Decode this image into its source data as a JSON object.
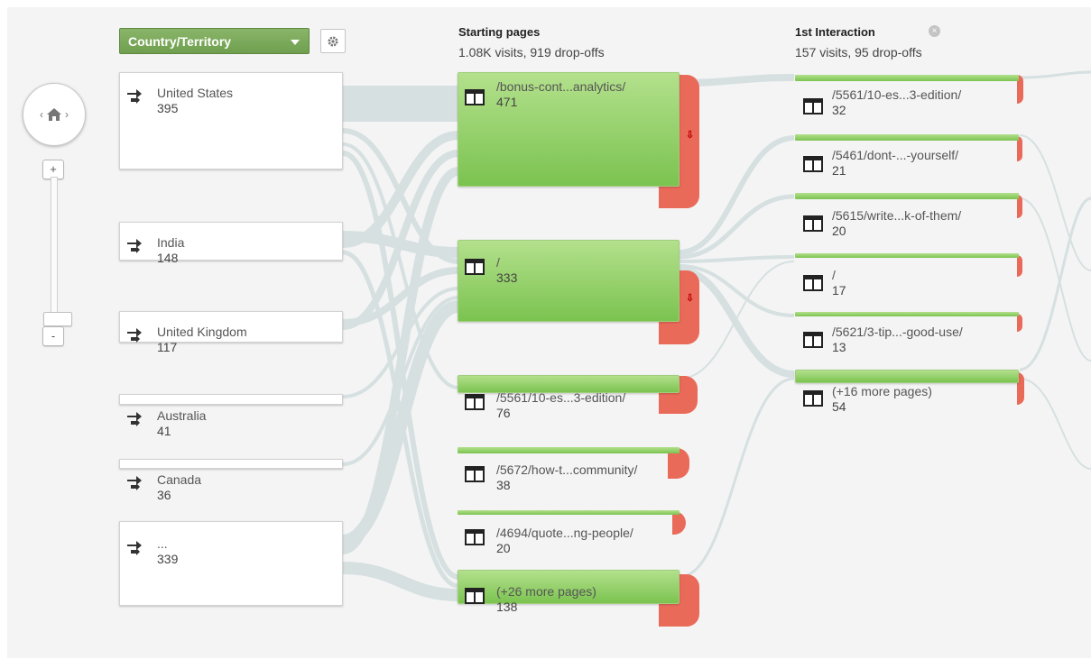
{
  "controls": {
    "home_icon": "home-icon",
    "zoom_in_label": "+",
    "zoom_out_label": "-",
    "dimension_select_value": "Country/Territory",
    "settings_icon": "gear-icon"
  },
  "columns": [
    {
      "title": "Starting pages",
      "summary": "1.08K visits, 919 drop-offs"
    },
    {
      "title": "1st Interaction",
      "summary": "157 visits, 95 drop-offs"
    }
  ],
  "countries": [
    {
      "name": "United States",
      "count": "395"
    },
    {
      "name": "India",
      "count": "148"
    },
    {
      "name": "United Kingdom",
      "count": "117"
    },
    {
      "name": "Australia",
      "count": "41"
    },
    {
      "name": "Canada",
      "count": "36"
    },
    {
      "name": "...",
      "count": "339"
    }
  ],
  "starting_pages": [
    {
      "name": "/bonus-cont...analytics/",
      "count": "471"
    },
    {
      "name": "/",
      "count": "333"
    },
    {
      "name": "/5561/10-es...3-edition/",
      "count": "76"
    },
    {
      "name": "/5672/how-t...community/",
      "count": "38"
    },
    {
      "name": "/4694/quote...ng-people/",
      "count": "20"
    },
    {
      "name": "(+26 more pages)",
      "count": "138"
    }
  ],
  "first_interaction": [
    {
      "name": "/5561/10-es...3-edition/",
      "count": "32"
    },
    {
      "name": "/5461/dont-...-yourself/",
      "count": "21"
    },
    {
      "name": "/5615/write...k-of-them/",
      "count": "20"
    },
    {
      "name": "/",
      "count": "17"
    },
    {
      "name": "/5621/3-tip...-good-use/",
      "count": "13"
    },
    {
      "name": "(+16 more pages)",
      "count": "54"
    }
  ],
  "colors": {
    "node_green": "#7bc350",
    "dropoff_red": "#ea6a5a",
    "flow_gray": "#d3dedf",
    "select_green": "#6f9f4f"
  }
}
